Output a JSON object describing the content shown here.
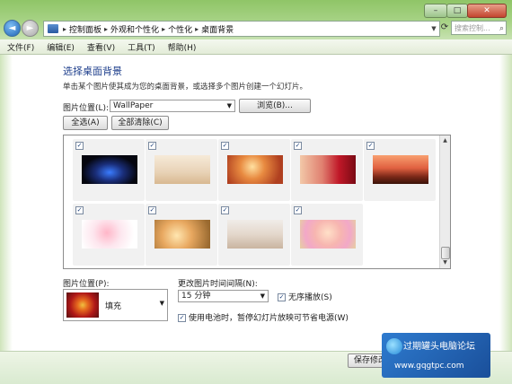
{
  "window": {
    "minimize_glyph": "–",
    "maximize_glyph": "□",
    "close_glyph": "✕"
  },
  "nav": {
    "back_glyph": "◄",
    "forward_glyph": "►",
    "breadcrumbs": [
      "控制面板",
      "外观和个性化",
      "个性化",
      "桌面背景"
    ],
    "search_placeholder": "搜索控制..."
  },
  "menu": [
    "文件(F)",
    "编辑(E)",
    "查看(V)",
    "工具(T)",
    "帮助(H)"
  ],
  "content": {
    "heading": "选择桌面背景",
    "subtext": "单击某个图片使其成为您的桌面背景，或选择多个图片创建一个幻灯片。",
    "location_label": "图片位置(L):",
    "location_value": "WallPaper",
    "browse_label": "浏览(B)...",
    "select_all_label": "全选(A)",
    "clear_all_label": "全部清除(C)"
  },
  "gallery": {
    "items": [
      {
        "checked": true,
        "icon": "car-wallpaper"
      },
      {
        "checked": true,
        "icon": "teapot-wallpaper"
      },
      {
        "checked": true,
        "icon": "autumn-wallpaper"
      },
      {
        "checked": true,
        "icon": "girl-roses-wallpaper"
      },
      {
        "checked": true,
        "icon": "sunset-wallpaper"
      },
      {
        "checked": true,
        "icon": "cartoon-wallpaper"
      },
      {
        "checked": true,
        "icon": "doll-wallpaper"
      },
      {
        "checked": true,
        "icon": "bear-wallpaper"
      },
      {
        "checked": true,
        "icon": "girl-flowers-wallpaper"
      }
    ]
  },
  "bottom": {
    "position_label": "图片位置(P):",
    "position_value": "填充",
    "interval_label": "更改图片时间间隔(N):",
    "interval_value": "15 分钟",
    "shuffle_label": "无序播放(S)",
    "shuffle_checked": true,
    "battery_label": "使用电池时，暂停幻灯片放映可节省电源(W)",
    "battery_checked": true,
    "save_label": "保存修改"
  },
  "watermark": {
    "title": "过期罐头电脑论坛",
    "url": "www.gqgtpc.com"
  },
  "colors": {
    "heading": "#1e3f8c",
    "accent_green": "#8fc567",
    "close_red": "#c3452f"
  }
}
